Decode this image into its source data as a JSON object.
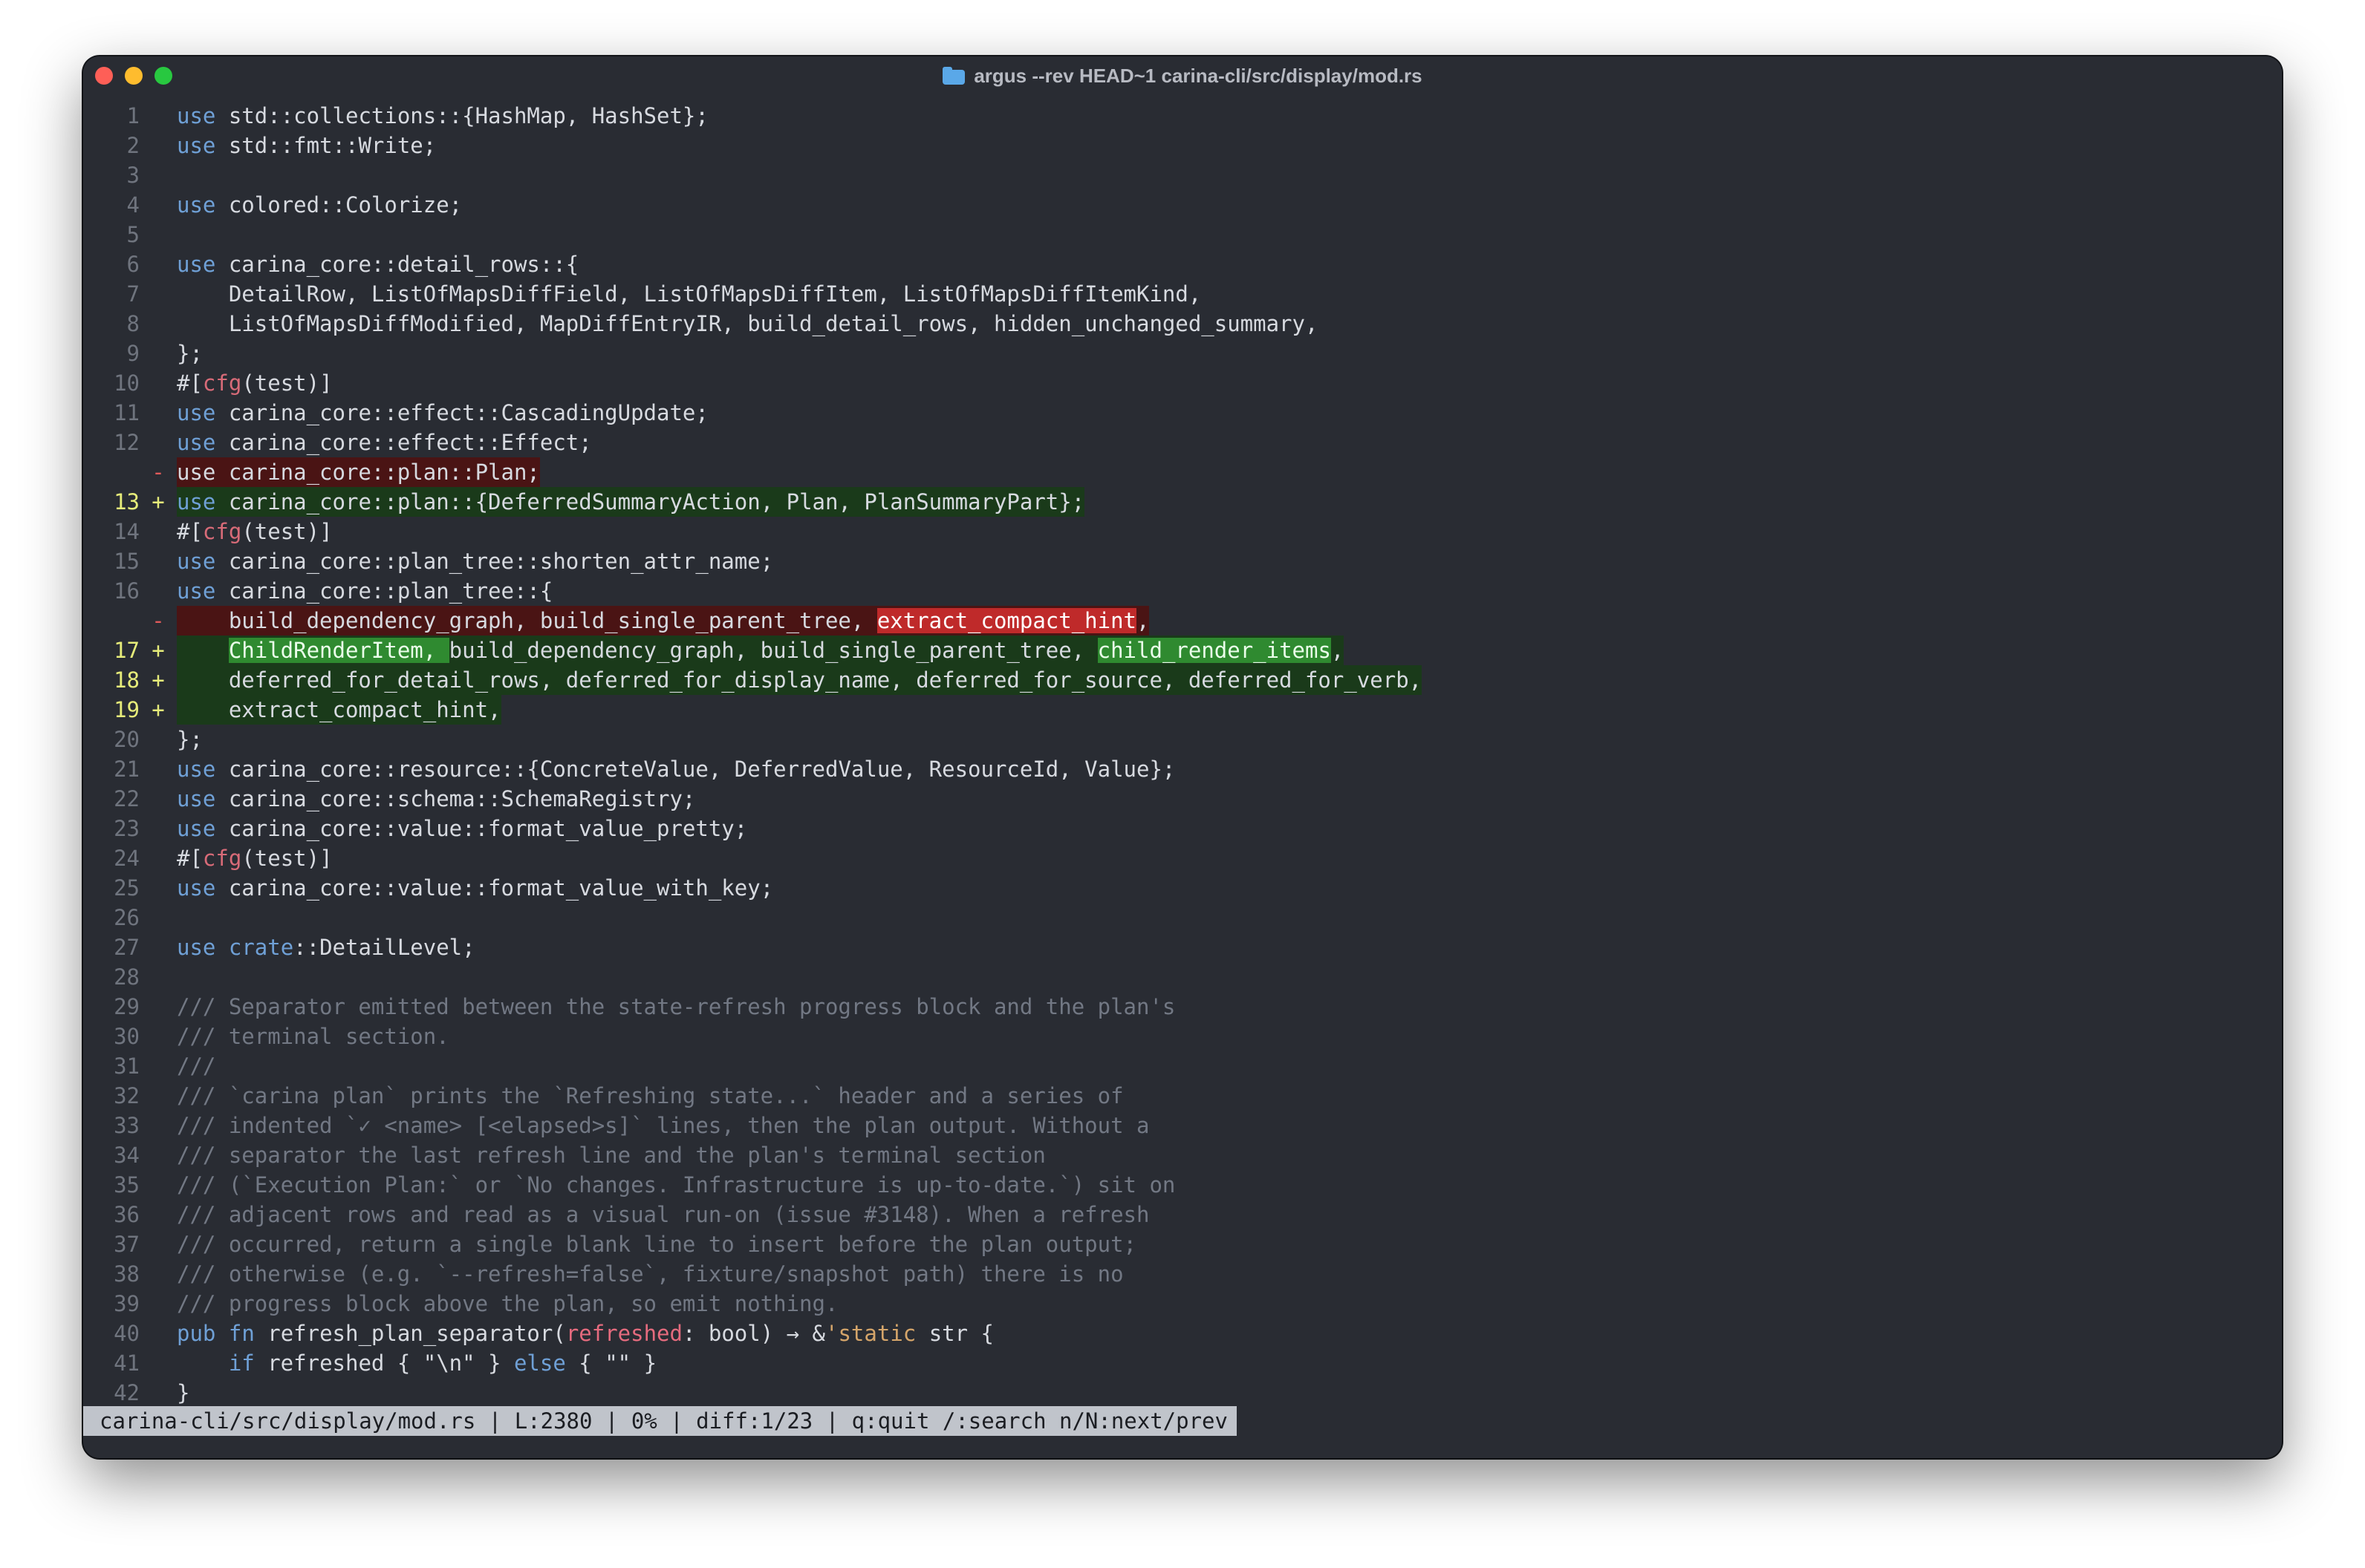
{
  "window": {
    "title": "argus --rev HEAD~1 carina-cli/src/display/mod.rs",
    "colors": {
      "background": "#292c33",
      "added": "#1a3a1a",
      "removed": "#4a1414",
      "inline_added": "#2f8a30",
      "inline_removed": "#bf2a2a",
      "keyword": "#6fa0d6",
      "attribute": "#d86b78",
      "comment": "#727884"
    }
  },
  "code": {
    "lines": [
      {
        "num": "1",
        "sign": "",
        "type": "ctx",
        "tokens": [
          {
            "t": "use",
            "c": "kw"
          },
          {
            "t": " std::collections::{HashMap, HashSet};"
          }
        ]
      },
      {
        "num": "2",
        "sign": "",
        "type": "ctx",
        "tokens": [
          {
            "t": "use",
            "c": "kw"
          },
          {
            "t": " std::fmt::Write;"
          }
        ]
      },
      {
        "num": "3",
        "sign": "",
        "type": "ctx",
        "tokens": []
      },
      {
        "num": "4",
        "sign": "",
        "type": "ctx",
        "tokens": [
          {
            "t": "use",
            "c": "kw"
          },
          {
            "t": " colored::Colorize;"
          }
        ]
      },
      {
        "num": "5",
        "sign": "",
        "type": "ctx",
        "tokens": []
      },
      {
        "num": "6",
        "sign": "",
        "type": "ctx",
        "tokens": [
          {
            "t": "use",
            "c": "kw"
          },
          {
            "t": " carina_core::detail_rows::{"
          }
        ]
      },
      {
        "num": "7",
        "sign": "",
        "type": "ctx",
        "tokens": [
          {
            "t": "    DetailRow, ListOfMapsDiffField, ListOfMapsDiffItem, ListOfMapsDiffItemKind,"
          }
        ]
      },
      {
        "num": "8",
        "sign": "",
        "type": "ctx",
        "tokens": [
          {
            "t": "    ListOfMapsDiffModified, MapDiffEntryIR, build_detail_rows, hidden_unchanged_summary,"
          }
        ]
      },
      {
        "num": "9",
        "sign": "",
        "type": "ctx",
        "tokens": [
          {
            "t": "};"
          }
        ]
      },
      {
        "num": "10",
        "sign": "",
        "type": "ctx",
        "tokens": [
          {
            "t": "#["
          },
          {
            "t": "cfg",
            "c": "attr"
          },
          {
            "t": "(test)]"
          }
        ]
      },
      {
        "num": "11",
        "sign": "",
        "type": "ctx",
        "tokens": [
          {
            "t": "use",
            "c": "kw"
          },
          {
            "t": " carina_core::effect::CascadingUpdate;"
          }
        ]
      },
      {
        "num": "12",
        "sign": "",
        "type": "ctx",
        "tokens": [
          {
            "t": "use",
            "c": "kw"
          },
          {
            "t": " carina_core::effect::Effect;"
          }
        ]
      },
      {
        "num": "",
        "sign": "-",
        "type": "del",
        "tokens": [
          {
            "t": "use carina_core::plan::Plan;"
          }
        ]
      },
      {
        "num": "13",
        "sign": "+",
        "type": "add",
        "tokens": [
          {
            "t": "use",
            "c": "kw"
          },
          {
            "t": " carina_core::plan::{DeferredSummaryAction, Plan, PlanSummaryPart};"
          }
        ]
      },
      {
        "num": "14",
        "sign": "",
        "type": "ctx",
        "tokens": [
          {
            "t": "#["
          },
          {
            "t": "cfg",
            "c": "attr"
          },
          {
            "t": "(test)]"
          }
        ]
      },
      {
        "num": "15",
        "sign": "",
        "type": "ctx",
        "tokens": [
          {
            "t": "use",
            "c": "kw"
          },
          {
            "t": " carina_core::plan_tree::shorten_attr_name;"
          }
        ]
      },
      {
        "num": "16",
        "sign": "",
        "type": "ctx",
        "tokens": [
          {
            "t": "use",
            "c": "kw"
          },
          {
            "t": " carina_core::plan_tree::{"
          }
        ]
      },
      {
        "num": "",
        "sign": "-",
        "type": "del",
        "tokens": [
          {
            "t": "    build_dependency_graph, build_single_parent_tree, "
          },
          {
            "t": "extract_compact_hint",
            "c": "idel"
          },
          {
            "t": ","
          }
        ]
      },
      {
        "num": "17",
        "sign": "+",
        "type": "add",
        "tokens": [
          {
            "t": "    "
          },
          {
            "t": "ChildRenderItem, ",
            "c": "iadd"
          },
          {
            "t": "build_dependency_graph, build_single_parent_tree, "
          },
          {
            "t": "child_render_items",
            "c": "iadd"
          },
          {
            "t": ","
          }
        ]
      },
      {
        "num": "18",
        "sign": "+",
        "type": "add",
        "tokens": [
          {
            "t": "    deferred_for_detail_rows, deferred_for_display_name, deferred_for_source, deferred_for_verb,"
          }
        ]
      },
      {
        "num": "19",
        "sign": "+",
        "type": "add",
        "tokens": [
          {
            "t": "    extract_compact_hint,"
          }
        ]
      },
      {
        "num": "20",
        "sign": "",
        "type": "ctx",
        "tokens": [
          {
            "t": "};"
          }
        ]
      },
      {
        "num": "21",
        "sign": "",
        "type": "ctx",
        "tokens": [
          {
            "t": "use",
            "c": "kw"
          },
          {
            "t": " carina_core::resource::{ConcreteValue, DeferredValue, ResourceId, Value};"
          }
        ]
      },
      {
        "num": "22",
        "sign": "",
        "type": "ctx",
        "tokens": [
          {
            "t": "use",
            "c": "kw"
          },
          {
            "t": " carina_core::schema::SchemaRegistry;"
          }
        ]
      },
      {
        "num": "23",
        "sign": "",
        "type": "ctx",
        "tokens": [
          {
            "t": "use",
            "c": "kw"
          },
          {
            "t": " carina_core::value::format_value_pretty;"
          }
        ]
      },
      {
        "num": "24",
        "sign": "",
        "type": "ctx",
        "tokens": [
          {
            "t": "#["
          },
          {
            "t": "cfg",
            "c": "attr"
          },
          {
            "t": "(test)]"
          }
        ]
      },
      {
        "num": "25",
        "sign": "",
        "type": "ctx",
        "tokens": [
          {
            "t": "use",
            "c": "kw"
          },
          {
            "t": " carina_core::value::format_value_with_key;"
          }
        ]
      },
      {
        "num": "26",
        "sign": "",
        "type": "ctx",
        "tokens": []
      },
      {
        "num": "27",
        "sign": "",
        "type": "ctx",
        "tokens": [
          {
            "t": "use",
            "c": "kw"
          },
          {
            "t": " "
          },
          {
            "t": "crate",
            "c": "kw"
          },
          {
            "t": "::DetailLevel;"
          }
        ]
      },
      {
        "num": "28",
        "sign": "",
        "type": "ctx",
        "tokens": []
      },
      {
        "num": "29",
        "sign": "",
        "type": "ctx",
        "tokens": [
          {
            "t": "/// Separator emitted between the state-refresh progress block and the plan's",
            "c": "cmt"
          }
        ]
      },
      {
        "num": "30",
        "sign": "",
        "type": "ctx",
        "tokens": [
          {
            "t": "/// terminal section.",
            "c": "cmt"
          }
        ]
      },
      {
        "num": "31",
        "sign": "",
        "type": "ctx",
        "tokens": [
          {
            "t": "///",
            "c": "cmt"
          }
        ]
      },
      {
        "num": "32",
        "sign": "",
        "type": "ctx",
        "tokens": [
          {
            "t": "/// `carina plan` prints the `Refreshing state...` header and a series of",
            "c": "cmt"
          }
        ]
      },
      {
        "num": "33",
        "sign": "",
        "type": "ctx",
        "tokens": [
          {
            "t": "/// indented `✓ <name> [<elapsed>s]` lines, then the plan output. Without a",
            "c": "cmt"
          }
        ]
      },
      {
        "num": "34",
        "sign": "",
        "type": "ctx",
        "tokens": [
          {
            "t": "/// separator the last refresh line and the plan's terminal section",
            "c": "cmt"
          }
        ]
      },
      {
        "num": "35",
        "sign": "",
        "type": "ctx",
        "tokens": [
          {
            "t": "/// (`Execution Plan:` or `No changes. Infrastructure is up-to-date.`) sit on",
            "c": "cmt"
          }
        ]
      },
      {
        "num": "36",
        "sign": "",
        "type": "ctx",
        "tokens": [
          {
            "t": "/// adjacent rows and read as a visual run-on (issue #3148). When a refresh",
            "c": "cmt"
          }
        ]
      },
      {
        "num": "37",
        "sign": "",
        "type": "ctx",
        "tokens": [
          {
            "t": "/// occurred, return a single blank line to insert before the plan output;",
            "c": "cmt"
          }
        ]
      },
      {
        "num": "38",
        "sign": "",
        "type": "ctx",
        "tokens": [
          {
            "t": "/// otherwise (e.g. `--refresh=false`, fixture/snapshot path) there is no",
            "c": "cmt"
          }
        ]
      },
      {
        "num": "39",
        "sign": "",
        "type": "ctx",
        "tokens": [
          {
            "t": "/// progress block above the plan, so emit nothing.",
            "c": "cmt"
          }
        ]
      },
      {
        "num": "40",
        "sign": "",
        "type": "ctx",
        "tokens": [
          {
            "t": "pub",
            "c": "kw"
          },
          {
            "t": " "
          },
          {
            "t": "fn",
            "c": "kw"
          },
          {
            "t": " refresh_plan_separator("
          },
          {
            "t": "refreshed",
            "c": "param"
          },
          {
            "t": ": bool) → &"
          },
          {
            "t": "'static",
            "c": "lt"
          },
          {
            "t": " str {"
          }
        ]
      },
      {
        "num": "41",
        "sign": "",
        "type": "ctx",
        "tokens": [
          {
            "t": "    "
          },
          {
            "t": "if",
            "c": "kw"
          },
          {
            "t": " refreshed { \"\\n\" } "
          },
          {
            "t": "else",
            "c": "kw"
          },
          {
            "t": " { \"\" }"
          }
        ]
      },
      {
        "num": "42",
        "sign": "",
        "type": "ctx",
        "tokens": [
          {
            "t": "}"
          }
        ]
      }
    ]
  },
  "status_bar": {
    "text": "carina-cli/src/display/mod.rs | L:2380 | 0% | diff:1/23 | q:quit /:search n/N:next/prev"
  }
}
